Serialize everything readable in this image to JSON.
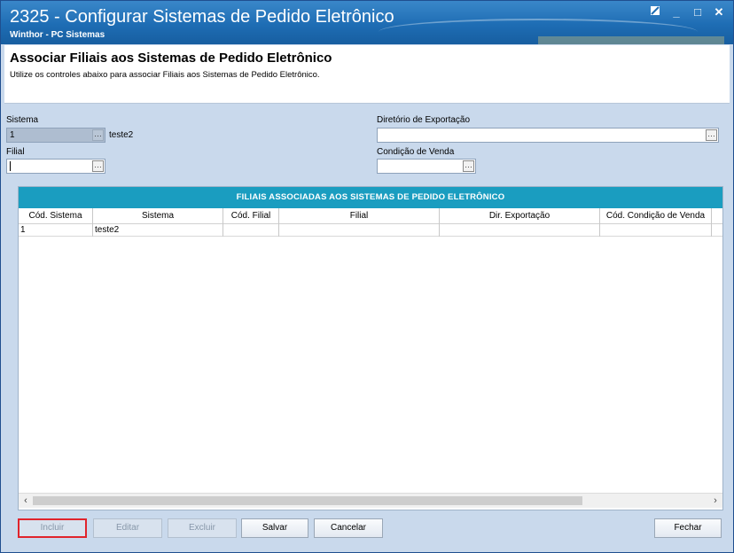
{
  "window": {
    "title": "2325 - Configurar Sistemas de Pedido Eletrônico",
    "subtitle": "Winthor - PC Sistemas"
  },
  "header": {
    "title": "Associar Filiais aos Sistemas de Pedido Eletrônico",
    "description": "Utilize os controles abaixo para associar Filiais aos Sistemas de Pedido Eletrônico."
  },
  "form": {
    "sistema_label": "Sistema",
    "sistema_code": "1",
    "sistema_name": "teste2",
    "filial_label": "Filial",
    "filial_value": "",
    "diretorio_label": "Diretório de Exportação",
    "diretorio_value": "",
    "condicao_label": "Condição de Venda",
    "condicao_value": ""
  },
  "grid": {
    "title": "FILIAIS ASSOCIADAS AOS SISTEMAS DE PEDIDO ELETRÔNICO",
    "columns": [
      "Cód. Sistema",
      "Sistema",
      "Cód. Filial",
      "Filial",
      "Dir. Exportação",
      "Cód. Condição de Venda"
    ],
    "rows": [
      [
        "1",
        "teste2",
        "",
        "",
        "",
        ""
      ]
    ]
  },
  "buttons": {
    "incluir": "Incluir",
    "editar": "Editar",
    "excluir": "Excluir",
    "salvar": "Salvar",
    "cancelar": "Cancelar",
    "fechar": "Fechar"
  },
  "colors": {
    "grid_header": "#1a9dc0",
    "titlebar": "#1e6db4",
    "focus_border": "#e0242c"
  }
}
